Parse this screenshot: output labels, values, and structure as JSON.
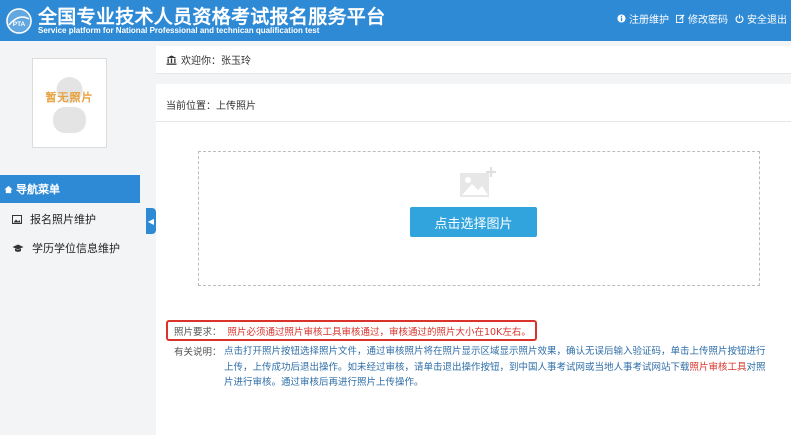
{
  "header": {
    "title": "全国专业技术人员资格考试报名服务平台",
    "subtitle": "Service platform for National Professional and technican qualification test",
    "logo_text": "PTA",
    "links": [
      {
        "icon": "info-icon",
        "label": "注册维护"
      },
      {
        "icon": "edit-icon",
        "label": "修改密码"
      },
      {
        "icon": "power-icon",
        "label": "安全退出"
      }
    ]
  },
  "sidebar": {
    "photo_placeholder": "暂无照片",
    "nav_header": "导航菜单",
    "items": [
      {
        "icon": "image-icon",
        "label": "报名照片维护"
      },
      {
        "icon": "graduation-cap-icon",
        "label": "学历学位信息维护"
      }
    ]
  },
  "welcome": {
    "icon": "bank-icon",
    "text": "欢迎你：张玉玲"
  },
  "main": {
    "breadcrumb": "当前位置：上传照片",
    "choose_button": "点击选择图片",
    "requirement_label": "照片要求：",
    "requirement_text": "照片必须通过照片审核工具审核通过，审核通过的照片大小在10K左右。",
    "note_label": "有关说明：",
    "note_text_1": "点击打开照片按钮选择照片文件，通过审核照片将在照片显示区域显示照片效果，确认无误后输入验证码，单击上传照片按钮进行上传，上传成功后退出操作。如未经过审核，请单击退出操作按钮，到中国人事考试网或当地人事考试网站下载",
    "note_tool": "照片审核工具",
    "note_text_2": "对照片进行审核。通过审核后再进行照片上传操作。"
  },
  "colors": {
    "primary": "#2f8ad6",
    "button": "#31a4de",
    "warning": "#d9332b",
    "placeholder_text": "#e8a23d"
  }
}
